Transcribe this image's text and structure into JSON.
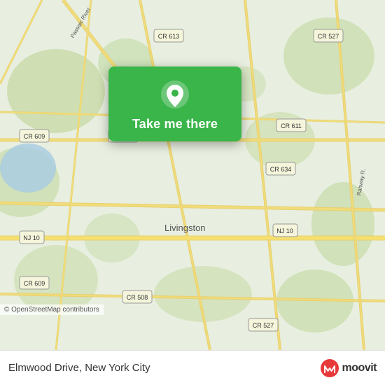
{
  "map": {
    "alt": "Map of Livingston, New Jersey area",
    "popup": {
      "button_label": "Take me there",
      "pin_color": "#ffffff"
    },
    "copyright": "© OpenStreetMap contributors"
  },
  "bottom_bar": {
    "address": "Elmwood Drive, New York City"
  },
  "moovit": {
    "wordmark": "moovit"
  }
}
